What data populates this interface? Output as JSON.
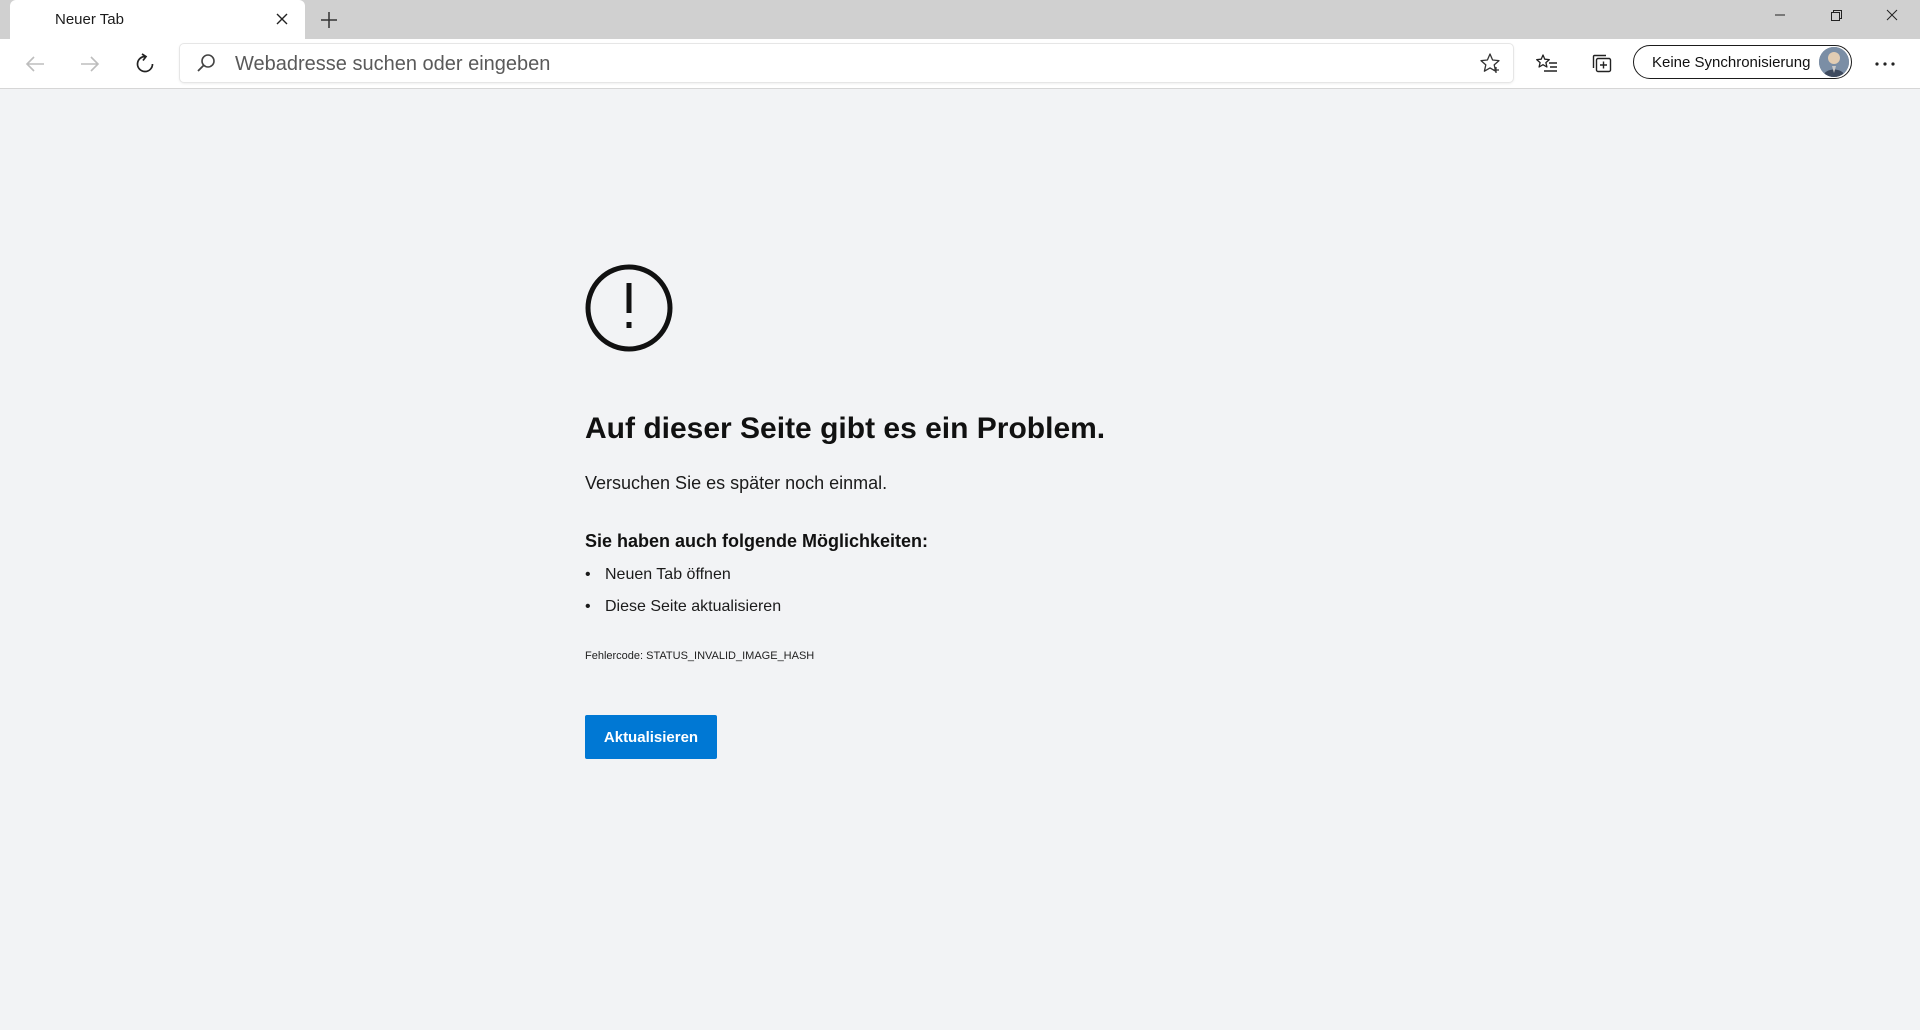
{
  "browser": {
    "tab": {
      "title": "Neuer Tab",
      "close_icon": "close-icon"
    },
    "new_tab_icon": "plus-icon",
    "window_controls": [
      "minimize-icon",
      "restore-icon",
      "close-icon"
    ],
    "toolbar": {
      "back_icon": "arrow-left-icon",
      "forward_icon": "arrow-right-icon",
      "refresh_icon": "refresh-icon",
      "address_placeholder": "Webadresse suchen oder eingeben",
      "address_value": "",
      "favorite_icon": "star-icon",
      "favorites_icon": "favorites-list-icon",
      "collections_icon": "collections-icon",
      "sync_label": "Keine Synchronisierung",
      "menu_icon": "more-icon"
    }
  },
  "error_page": {
    "icon": "exclamation-circle-icon",
    "heading": "Auf dieser Seite gibt es ein Problem.",
    "subtext": "Versuchen Sie es später noch einmal.",
    "options_heading": "Sie haben auch folgende Möglichkeiten:",
    "options": [
      "Neuen Tab öffnen",
      "Diese Seite aktualisieren"
    ],
    "error_code": "Fehlercode: STATUS_INVALID_IMAGE_HASH",
    "button_label": "Aktualisieren"
  },
  "colors": {
    "accent": "#0078d4",
    "page_background": "#f2f3f5",
    "tabstrip": "#d0d0d0"
  }
}
